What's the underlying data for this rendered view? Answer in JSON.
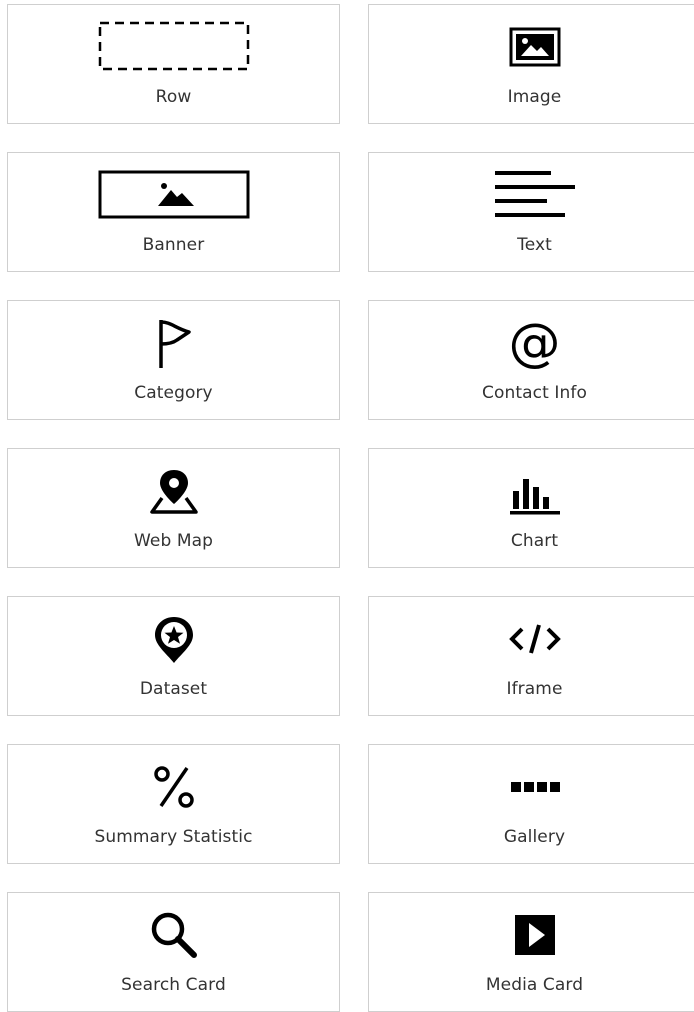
{
  "cards": [
    {
      "label": "Row",
      "icon": "row-icon"
    },
    {
      "label": "Image",
      "icon": "image-icon"
    },
    {
      "label": "Banner",
      "icon": "banner-icon"
    },
    {
      "label": "Text",
      "icon": "text-lines-icon"
    },
    {
      "label": "Category",
      "icon": "flag-icon"
    },
    {
      "label": "Contact Info",
      "icon": "at-sign-icon"
    },
    {
      "label": "Web Map",
      "icon": "map-pin-icon"
    },
    {
      "label": "Chart",
      "icon": "bar-chart-icon"
    },
    {
      "label": "Dataset",
      "icon": "star-pin-icon"
    },
    {
      "label": "Iframe",
      "icon": "code-icon"
    },
    {
      "label": "Summary Statistic",
      "icon": "percent-icon"
    },
    {
      "label": "Gallery",
      "icon": "dots-icon"
    },
    {
      "label": "Search Card",
      "icon": "search-icon"
    },
    {
      "label": "Media Card",
      "icon": "play-icon"
    }
  ],
  "colors": {
    "border": "#cfcfcf",
    "icon": "#000000",
    "label": "#333333"
  }
}
